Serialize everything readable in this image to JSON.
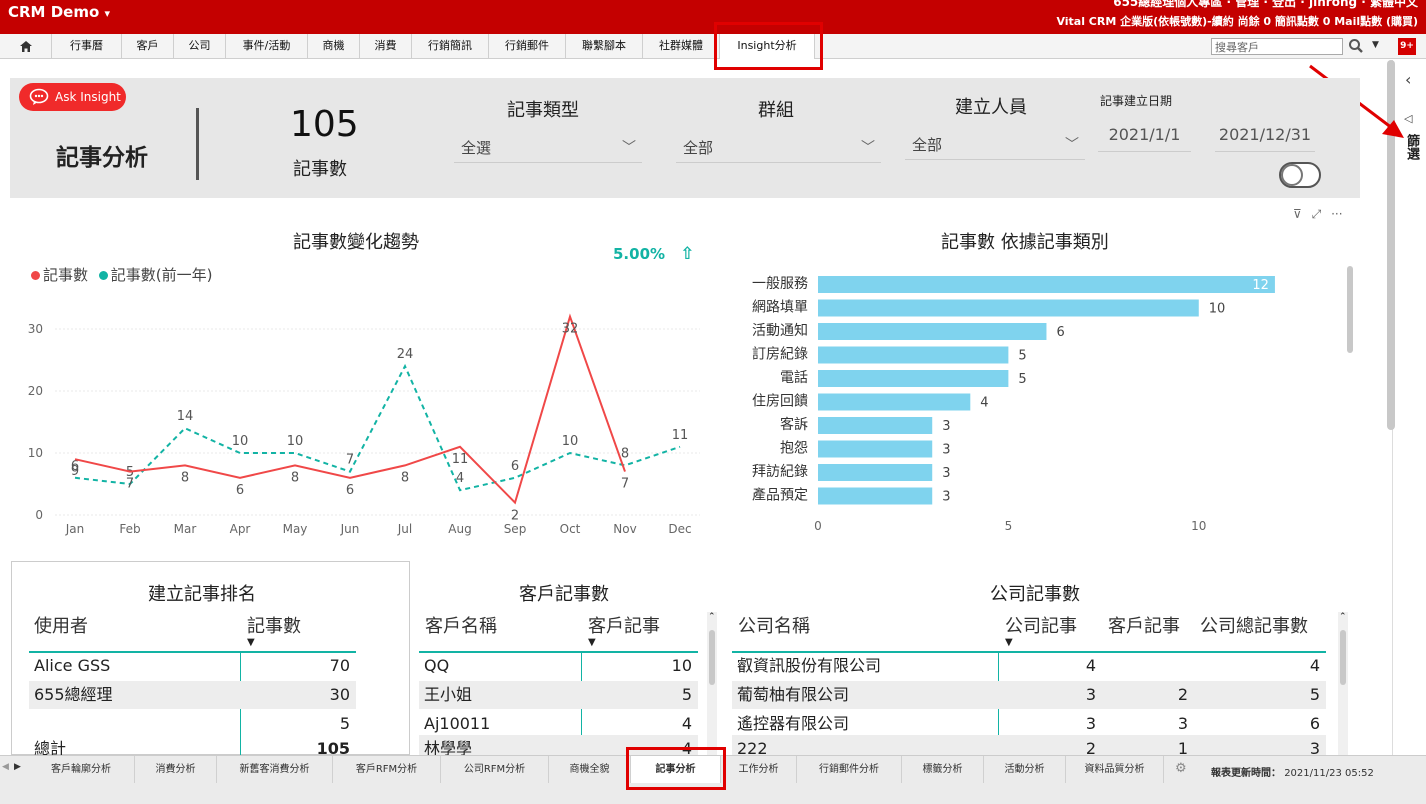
{
  "app": {
    "title": "CRM Demo",
    "title_caret": "▾",
    "top_right_line1": "655總經理個人專區 · 管理 · 登出 · jinrong · 繁體中文",
    "top_right_line2": "Vital CRM 企業版(依帳號數)-續約  尚餘 0 簡訊點數 0 Mail點數 (購買)"
  },
  "nav": {
    "items": [
      "行事曆",
      "客戶",
      "公司",
      "事件/活動",
      "商機",
      "消費",
      "行銷簡訊",
      "行銷郵件",
      "聯繫腳本",
      "社群媒體",
      "Insight分析"
    ],
    "search_placeholder": "搜尋客戶",
    "badge": "9+"
  },
  "filters": {
    "ask_label": "Ask Insight",
    "page_title": "記事分析",
    "kpi_value": "105",
    "kpi_label": "記事數",
    "type_label": "記事類型",
    "type_value": "全選",
    "group_label": "群組",
    "group_value": "全部",
    "creator_label": "建立人員",
    "creator_value": "全部",
    "date_label": "記事建立日期",
    "date_from": "2021/1/1",
    "date_to": "2021/12/31"
  },
  "right_panel": {
    "label": "篩選"
  },
  "line_chart": {
    "title": "記事數變化趨勢",
    "legend": [
      "記事數",
      "記事數(前一年)"
    ],
    "change": "5.00%",
    "change_arrow": "⇧"
  },
  "bar_chart": {
    "title": "記事數 依據記事類別"
  },
  "chart_data": [
    {
      "type": "line",
      "title": "記事數變化趨勢",
      "x": [
        "Jan",
        "Feb",
        "Mar",
        "Apr",
        "May",
        "Jun",
        "Jul",
        "Aug",
        "Sep",
        "Oct",
        "Nov",
        "Dec"
      ],
      "ylim": [
        0,
        35
      ],
      "yticks": [
        0,
        10,
        20,
        30
      ],
      "series": [
        {
          "name": "記事數",
          "color": "#f04848",
          "values": [
            9,
            7,
            8,
            6,
            8,
            6,
            8,
            11,
            2,
            32,
            7,
            null
          ]
        },
        {
          "name": "記事數(前一年)",
          "color": "#12b3a4",
          "values": [
            6,
            5,
            14,
            10,
            10,
            7,
            24,
            4,
            6,
            10,
            8,
            11
          ]
        }
      ]
    },
    {
      "type": "bar",
      "title": "記事數 依據記事類別",
      "categories": [
        "一般服務",
        "網路填單",
        "活動通知",
        "訂房紀錄",
        "電話",
        "住房回饋",
        "客訴",
        "抱怨",
        "拜訪紀錄",
        "產品預定"
      ],
      "values": [
        12,
        10,
        6,
        5,
        5,
        4,
        3,
        3,
        3,
        3
      ],
      "xlim": [
        0,
        13
      ],
      "xticks": [
        0,
        5,
        10
      ],
      "color": "#7fd3ee"
    }
  ],
  "ranking": {
    "title": "建立記事排名",
    "headers": [
      "使用者",
      "記事數"
    ],
    "rows": [
      [
        "Alice GSS",
        "70"
      ],
      [
        "655總經理",
        "30"
      ],
      [
        "",
        "5"
      ]
    ],
    "total_label": "總計",
    "total_value": "105"
  },
  "customers": {
    "title": "客戶記事數",
    "headers": [
      "客戶名稱",
      "客戶記事"
    ],
    "rows": [
      [
        "QQ",
        "10"
      ],
      [
        "王小姐",
        "5"
      ],
      [
        "Aj10011",
        "4"
      ],
      [
        "林學學",
        "4"
      ]
    ]
  },
  "companies": {
    "title": "公司記事數",
    "headers": [
      "公司名稱",
      "公司記事",
      "客戶記事",
      "公司總記事數"
    ],
    "rows": [
      [
        "叡資訊股份有限公司",
        "4",
        "",
        "4"
      ],
      [
        "葡萄柚有限公司",
        "3",
        "2",
        "5"
      ],
      [
        "遙控器有限公司",
        "3",
        "3",
        "6"
      ],
      [
        "222",
        "2",
        "1",
        "3"
      ]
    ]
  },
  "tabs": {
    "items": [
      "客戶輪廓分析",
      "消費分析",
      "新舊客消費分析",
      "客戶RFM分析",
      "公司RFM分析",
      "商機全貌",
      "記事分析",
      "工作分析",
      "行銷郵件分析",
      "標籤分析",
      "活動分析",
      "資料品質分析"
    ],
    "active": "記事分析",
    "refresh_label": "報表更新時間：",
    "refresh_time": "2021/11/23 05:52"
  }
}
